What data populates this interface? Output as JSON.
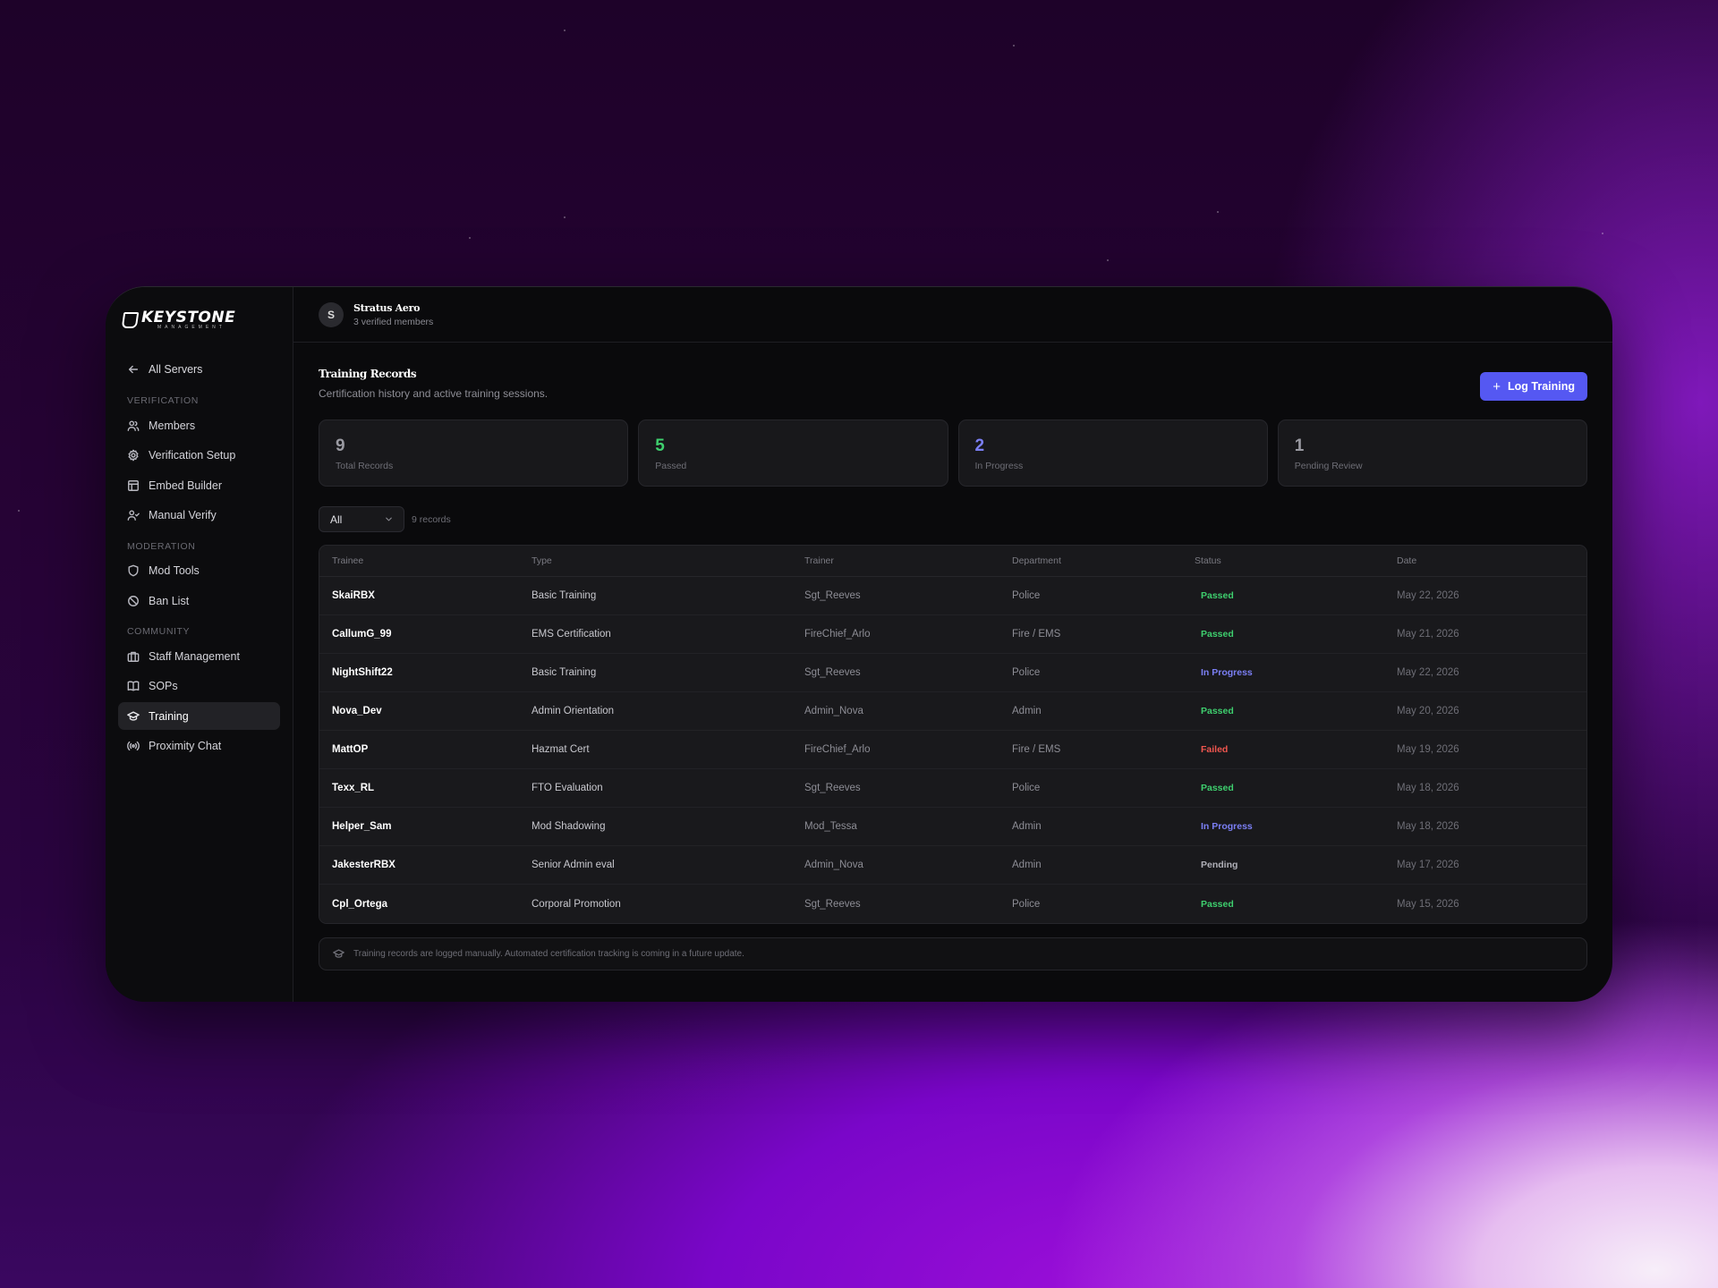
{
  "brand": {
    "name": "KEYSTONE",
    "tagline": "MANAGEMENT"
  },
  "sidebar": {
    "back_label": "All Servers",
    "sections": [
      {
        "label": "VERIFICATION",
        "items": [
          {
            "label": "Members",
            "icon": "users-icon"
          },
          {
            "label": "Verification Setup",
            "icon": "gear-icon"
          },
          {
            "label": "Embed Builder",
            "icon": "layout-icon"
          },
          {
            "label": "Manual Verify",
            "icon": "user-check-icon"
          }
        ]
      },
      {
        "label": "MODERATION",
        "items": [
          {
            "label": "Mod Tools",
            "icon": "shield-icon"
          },
          {
            "label": "Ban List",
            "icon": "ban-icon"
          }
        ]
      },
      {
        "label": "COMMUNITY",
        "items": [
          {
            "label": "Staff Management",
            "icon": "briefcase-icon"
          },
          {
            "label": "SOPs",
            "icon": "book-icon"
          },
          {
            "label": "Training",
            "icon": "graduation-cap-icon",
            "active": true
          },
          {
            "label": "Proximity Chat",
            "icon": "radio-icon"
          }
        ]
      }
    ]
  },
  "server": {
    "initial": "S",
    "name": "Stratus Aero",
    "subtitle": "3 verified members"
  },
  "page": {
    "title": "Training Records",
    "subtitle": "Certification history and active training sessions.",
    "log_button": "Log Training"
  },
  "stats": [
    {
      "value": "9",
      "label": "Total Records",
      "color": "#9a9aa2"
    },
    {
      "value": "5",
      "label": "Passed",
      "color": "#3ecf6e"
    },
    {
      "value": "2",
      "label": "In Progress",
      "color": "#7b7ff5"
    },
    {
      "value": "1",
      "label": "Pending Review",
      "color": "#9a9aa2"
    }
  ],
  "filter": {
    "selected": "All",
    "records_label": "9 records"
  },
  "table": {
    "columns": [
      "Trainee",
      "Type",
      "Trainer",
      "Department",
      "Status",
      "Date"
    ],
    "rows": [
      [
        "SkaiRBX",
        "Basic Training",
        "Sgt_Reeves",
        "Police",
        "Passed",
        "May 22, 2026"
      ],
      [
        "CallumG_99",
        "EMS Certification",
        "FireChief_Arlo",
        "Fire / EMS",
        "Passed",
        "May 21, 2026"
      ],
      [
        "NightShift22",
        "Basic Training",
        "Sgt_Reeves",
        "Police",
        "In Progress",
        "May 22, 2026"
      ],
      [
        "Nova_Dev",
        "Admin Orientation",
        "Admin_Nova",
        "Admin",
        "Passed",
        "May 20, 2026"
      ],
      [
        "MattOP",
        "Hazmat Cert",
        "FireChief_Arlo",
        "Fire / EMS",
        "Failed",
        "May 19, 2026"
      ],
      [
        "Texx_RL",
        "FTO Evaluation",
        "Sgt_Reeves",
        "Police",
        "Passed",
        "May 18, 2026"
      ],
      [
        "Helper_Sam",
        "Mod Shadowing",
        "Mod_Tessa",
        "Admin",
        "In Progress",
        "May 18, 2026"
      ],
      [
        "JakesterRBX",
        "Senior Admin eval",
        "Admin_Nova",
        "Admin",
        "Pending",
        "May 17, 2026"
      ],
      [
        "Cpl_Ortega",
        "Corporal Promotion",
        "Sgt_Reeves",
        "Police",
        "Passed",
        "May 15, 2026"
      ]
    ]
  },
  "status_colors": {
    "Passed": "#3ecf6e",
    "In Progress": "#7b7ff5",
    "Failed": "#f0564f",
    "Pending": "#b0b0b8"
  },
  "footnote": "Training records are logged manually. Automated certification tracking is coming in a future update."
}
